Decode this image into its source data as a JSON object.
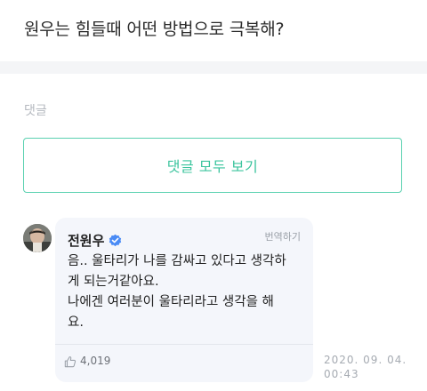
{
  "question": {
    "title": "원우는 힘들때 어떤 방법으로 극복해?"
  },
  "comments_section": {
    "label": "댓글",
    "view_all_label": "댓글 모두 보기"
  },
  "comment": {
    "author": "전원우",
    "translate_label": "번역하기",
    "text": "음.. 울타리가 나를 감싸고 있다고 생각하\n게 되는거같아요.\n나에겐 여러분이 울타리라고 생각을 해\n요.",
    "likes": "4,019",
    "date": "2020. 09. 04.",
    "time": "00:43",
    "icons": {
      "verified": "verified-check-icon",
      "like": "thumbs-up-icon"
    }
  },
  "colors": {
    "accent": "#3cc49e",
    "verified": "#4a8bf5",
    "bubble_bg": "#f4f6fb"
  }
}
